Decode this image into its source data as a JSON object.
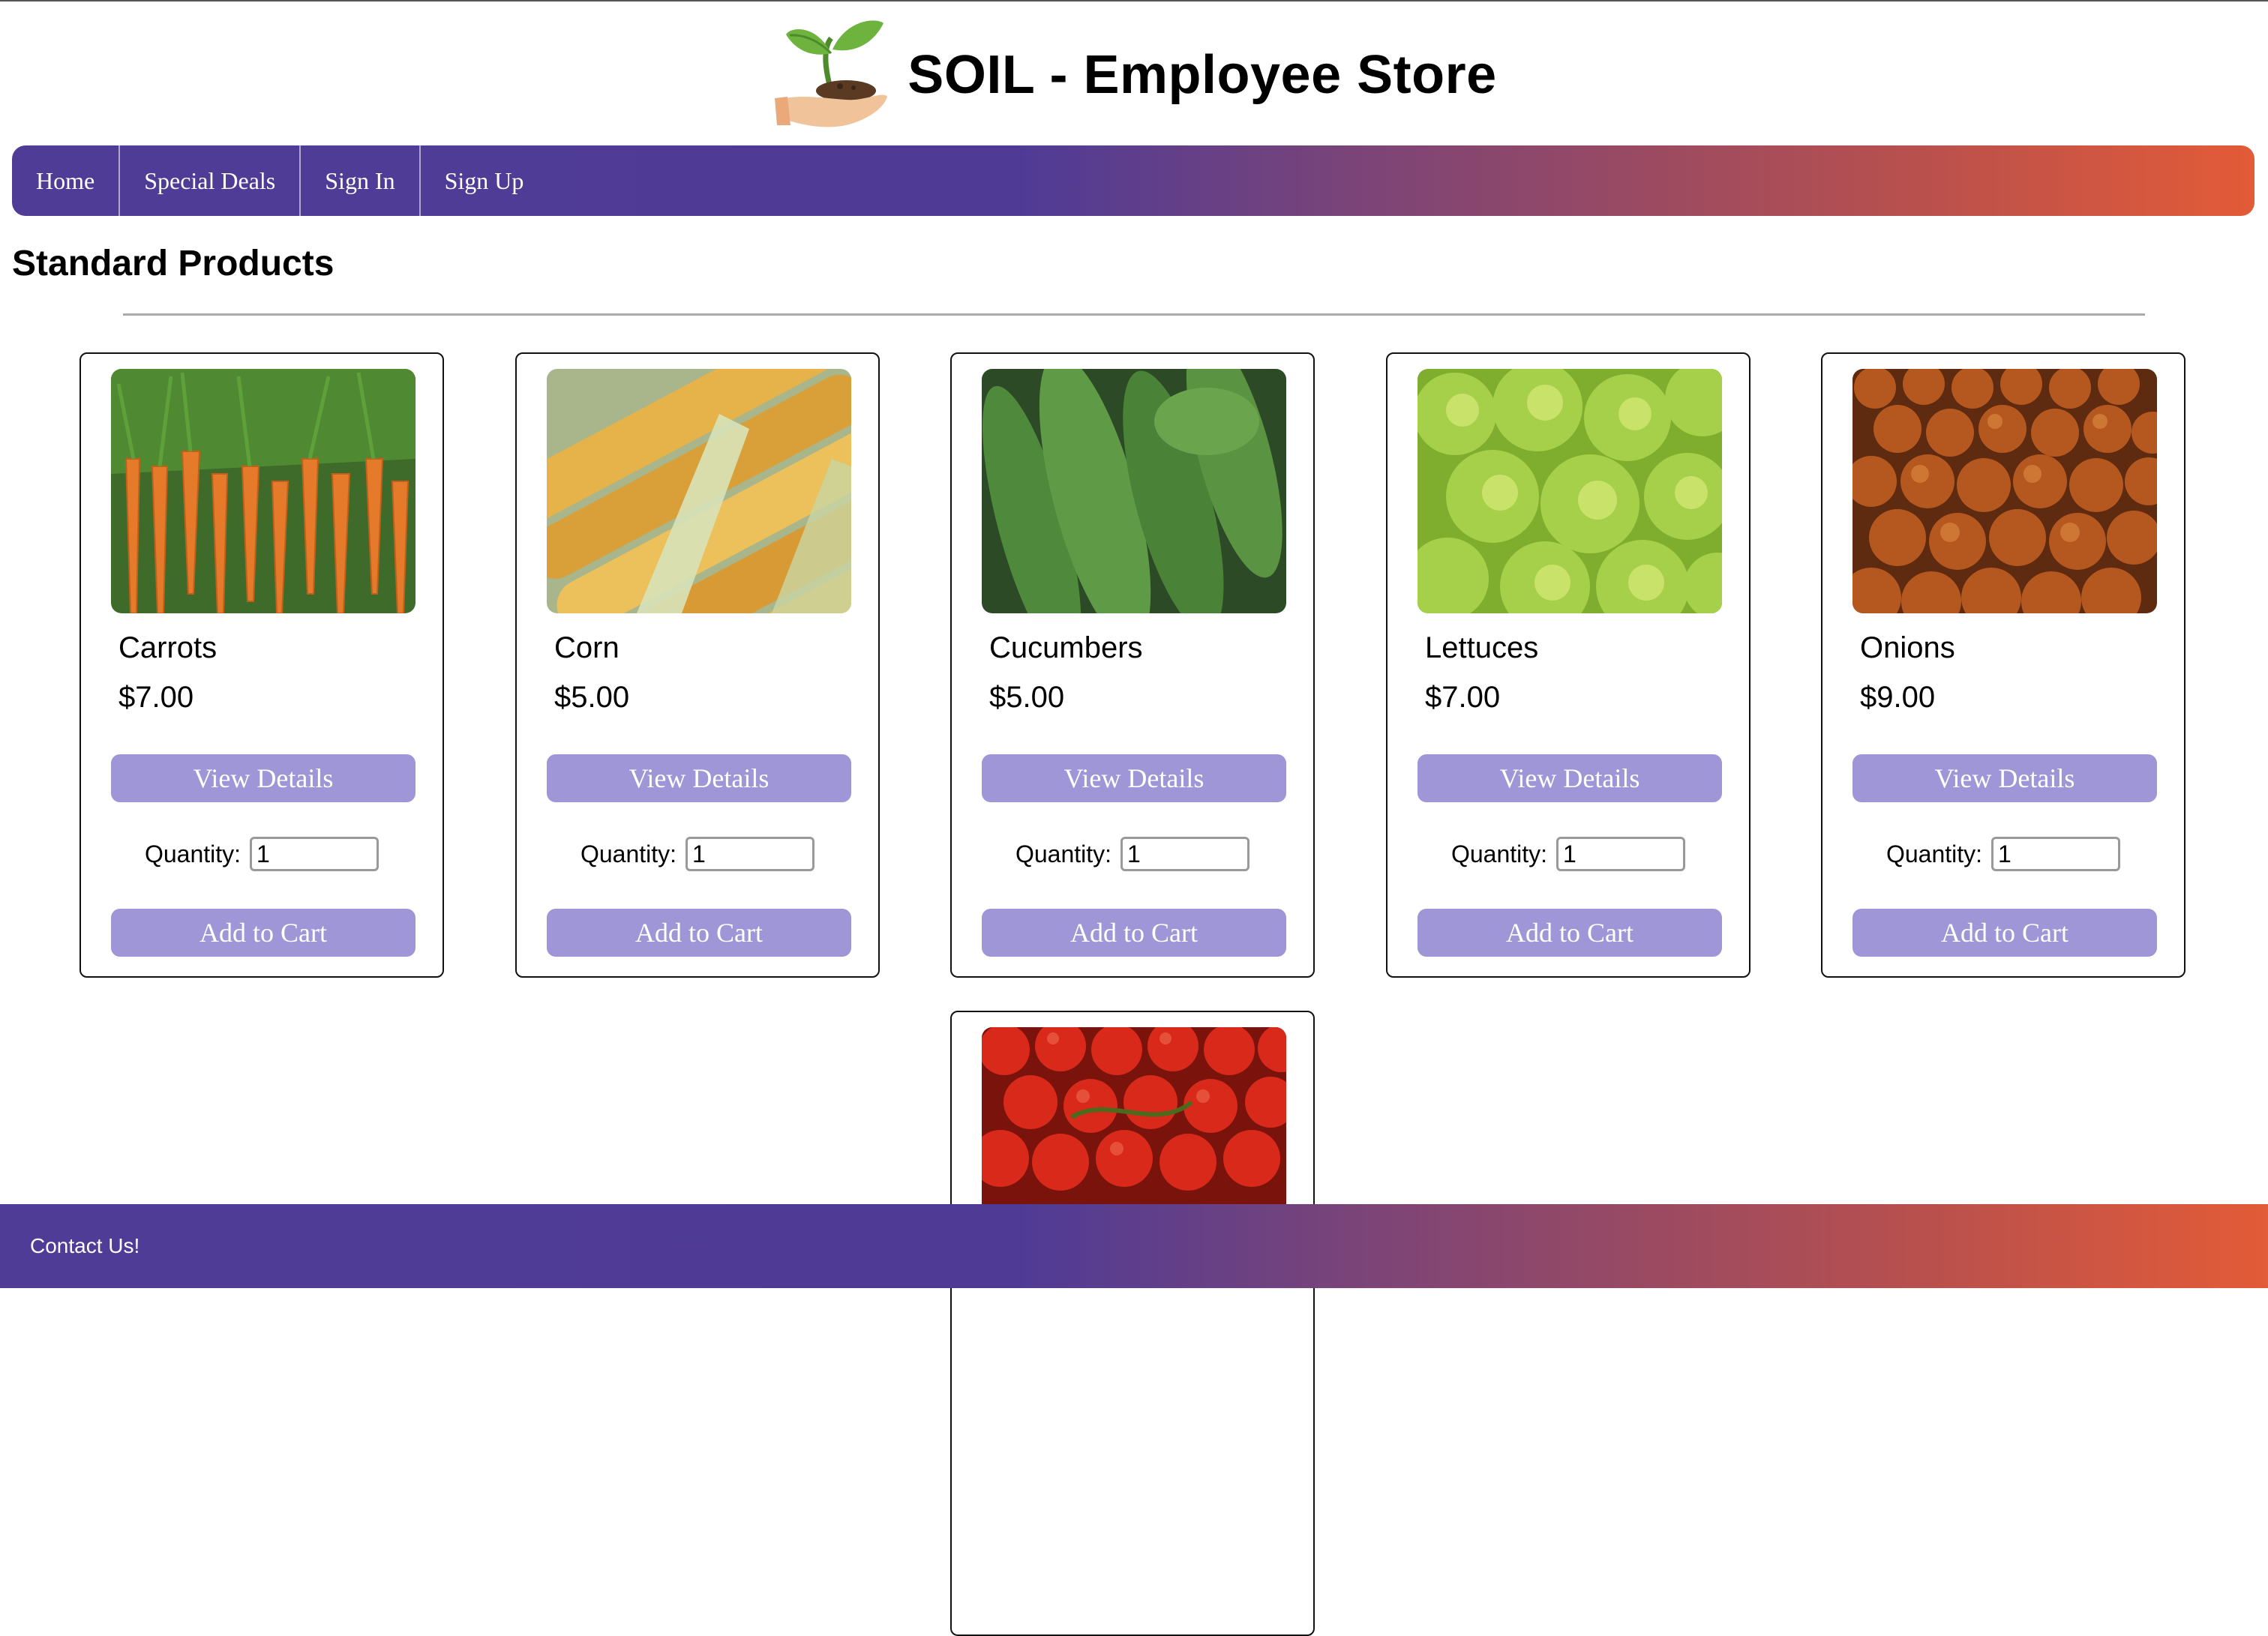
{
  "header": {
    "title": "SOIL - Employee Store",
    "logo_icon": "hand-sprout-icon"
  },
  "nav": {
    "items": [
      {
        "label": "Home"
      },
      {
        "label": "Special Deals"
      },
      {
        "label": "Sign In"
      },
      {
        "label": "Sign Up"
      }
    ]
  },
  "section": {
    "title": "Standard Products"
  },
  "product_ui": {
    "view_label": "View Details",
    "quantity_label": "Quantity:",
    "add_label": "Add to Cart"
  },
  "products": [
    {
      "name": "Carrots",
      "price": "$7.00",
      "quantity": "1",
      "image": "carrots"
    },
    {
      "name": "Corn",
      "price": "$5.00",
      "quantity": "1",
      "image": "corn"
    },
    {
      "name": "Cucumbers",
      "price": "$5.00",
      "quantity": "1",
      "image": "cucumbers"
    },
    {
      "name": "Lettuces",
      "price": "$7.00",
      "quantity": "1",
      "image": "lettuces"
    },
    {
      "name": "Onions",
      "price": "$9.00",
      "quantity": "1",
      "image": "onions"
    },
    {
      "image": "tomatoes"
    }
  ],
  "footer": {
    "contact_label": "Contact Us!"
  },
  "colors": {
    "gradient_start": "#4f3c97",
    "gradient_end": "#e35b37",
    "button": "#9e96d6"
  }
}
